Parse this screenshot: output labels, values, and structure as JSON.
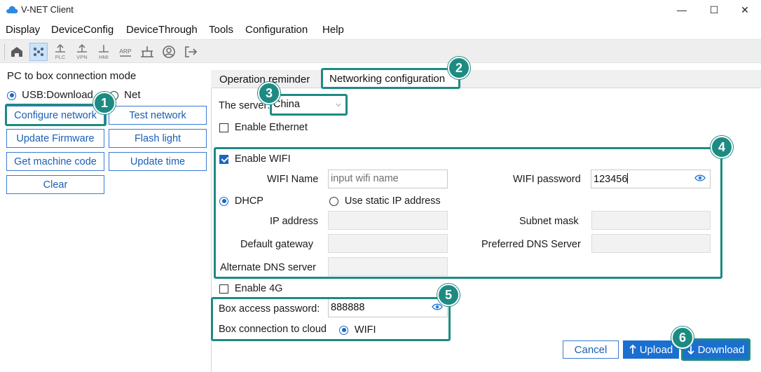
{
  "window": {
    "title": "V-NET Client",
    "controls": {
      "minimize": "—",
      "maximize": "☐",
      "close": "✕"
    }
  },
  "menu": [
    "Display",
    "DeviceConfig",
    "DeviceThrough",
    "Tools",
    "Configuration",
    "Help"
  ],
  "toolbar": {
    "buttons": [
      "home-icon",
      "network-icon",
      "plc-icon",
      "vpn-icon",
      "hmi-icon",
      "arp-icon",
      "switch-icon",
      "user-icon",
      "exit-icon"
    ],
    "labels": {
      "plc": "PLC",
      "vpn": "VPN",
      "hmi": "HMI",
      "arp": "ARP"
    }
  },
  "left": {
    "mode_label": "PC to box connection mode",
    "mode_options": [
      "USB:Download",
      "Net"
    ],
    "buttons": {
      "configure_network": "Configure network",
      "test_network": "Test network",
      "update_firmware": "Update Firmware",
      "flash_light": "Flash light",
      "get_machine_code": "Get machine code",
      "update_time": "Update time",
      "clear": "Clear"
    }
  },
  "tabs": {
    "operation_reminder": "Operation reminder",
    "networking_configuration": "Networking configuration"
  },
  "form": {
    "server_label": "The server:",
    "server_value": "China",
    "enable_ethernet": "Enable Ethernet",
    "enable_wifi": "Enable WIFI",
    "wifi_name_label": "WIFI Name",
    "wifi_name_placeholder": "input wifi name",
    "wifi_password_label": "WIFI password",
    "wifi_password_value": "123456",
    "dhcp": "DHCP",
    "static_ip": "Use static IP address",
    "ip_address": "IP address",
    "subnet_mask": "Subnet mask",
    "default_gateway": "Default gateway",
    "preferred_dns": "Preferred DNS Server",
    "alternate_dns": "Alternate DNS server",
    "enable_4g": "Enable 4G",
    "box_password_label": "Box access password:",
    "box_password_value": "888888",
    "cloud_label": "Box connection to cloud",
    "cloud_option": "WIFI"
  },
  "actions": {
    "cancel": "Cancel",
    "upload": "Upload",
    "download": "Download"
  },
  "badges": [
    "1",
    "2",
    "3",
    "4",
    "5",
    "6"
  ],
  "colors": {
    "accent": "#1a66c4",
    "callout": "#1d8b82",
    "button_blue": "#1a6fd1"
  }
}
